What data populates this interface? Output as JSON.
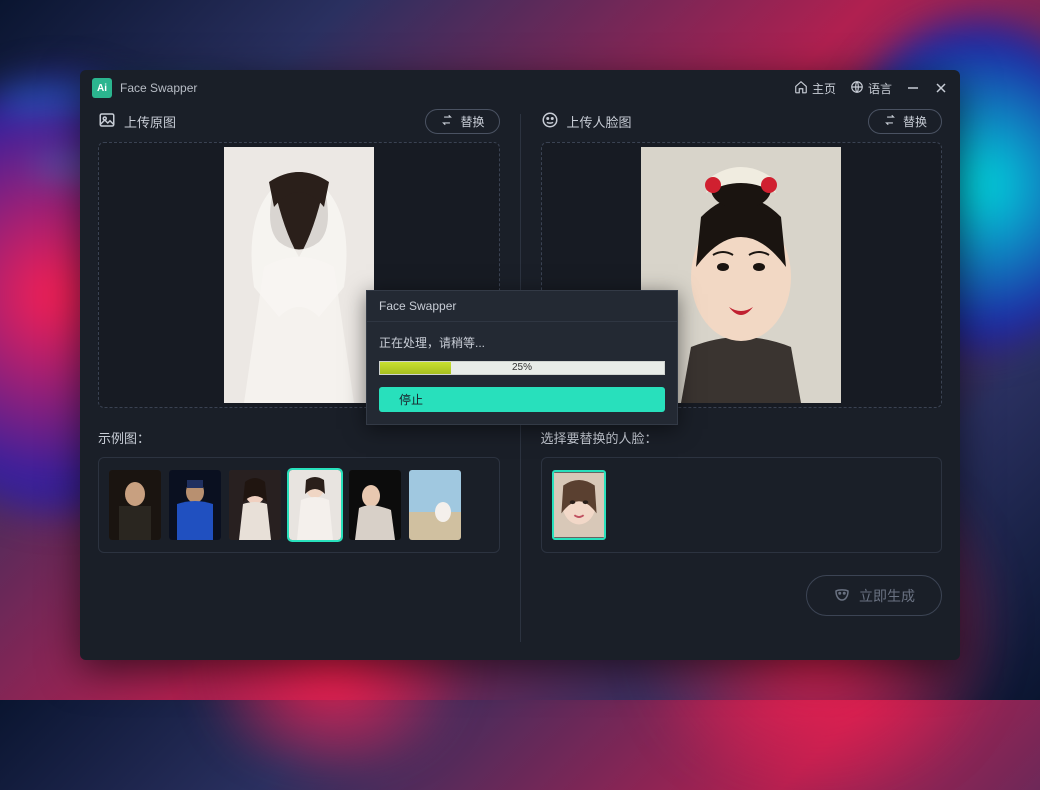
{
  "app": {
    "title": "Face Swapper",
    "logo_text": "Ai"
  },
  "titlebar": {
    "home": "主页",
    "language": "语言"
  },
  "left": {
    "upload_label": "上传原图",
    "replace_btn": "替换",
    "examples_label": "示例图：",
    "selected_example_index": 3
  },
  "right": {
    "upload_label": "上传人脸图",
    "replace_btn": "替换",
    "select_face_label": "选择要替换的人脸：",
    "generate_btn": "立即生成"
  },
  "modal": {
    "title": "Face Swapper",
    "message": "正在处理，请稍等...",
    "progress_pct": 25,
    "progress_text": "25%",
    "stop_btn": "停止"
  },
  "colors": {
    "accent": "#28e0bc",
    "panel": "#1a1f28"
  }
}
